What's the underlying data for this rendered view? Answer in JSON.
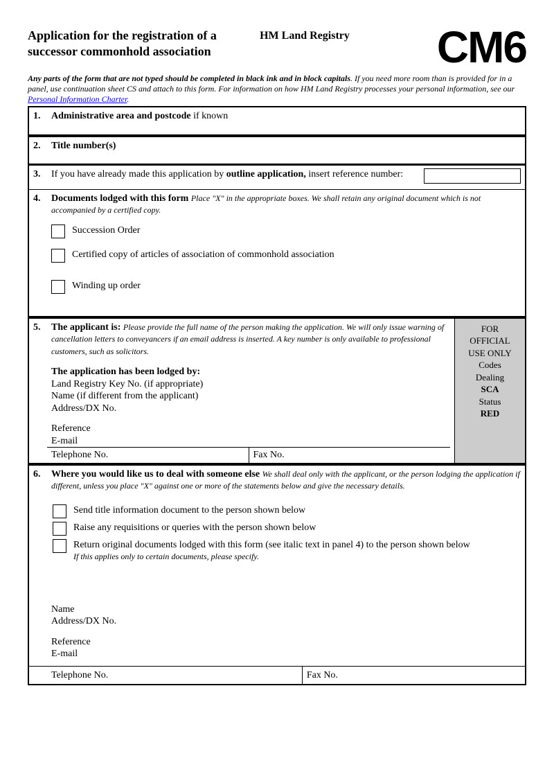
{
  "header": {
    "title": "Application for the registration of a successor commonhold association",
    "registry": "HM Land Registry",
    "form_code": "CM6"
  },
  "instruct": {
    "line": "Any parts of the form that are not typed should be completed in black ink and in block capitals",
    "cont": ". If you need more room than is provided for in a panel, use continuation sheet CS and attach to this form. For information on how HM Land Registry processes your personal information, see our ",
    "link_text": "Personal Information Charter",
    "fullstop": "."
  },
  "p1": {
    "num": "1.",
    "label_bold": "Administrative area and postcode",
    "tail": " if known"
  },
  "p2": {
    "num": "2.",
    "label": "Title number(s)"
  },
  "p3": {
    "num": "3.",
    "pre": "If you have already made this application by ",
    "mid": "outline application,",
    "post": " insert reference number:"
  },
  "p4": {
    "num": "4.",
    "head": "Documents lodged with this form",
    "note": " Place \"X\" in the appropriate boxes.  We shall retain any original document which is not accompanied by a certified copy.",
    "items": [
      "Succession Order",
      "Certified copy of articles of association of commonhold association",
      "Winding up order"
    ]
  },
  "p5": {
    "num": "5.",
    "head": "The applicant is:",
    "note": " Please provide the full name of the person making the application. We will only issue warning of cancellation letters to conveyancers if an email address is inserted. A key number is only available to professional customers, such as solicitors.",
    "lodged_head": "The application has been lodged by:",
    "lines": [
      "Land Registry Key No. (if appropriate)",
      "Name (if different from the applicant)",
      "Address/DX No."
    ],
    "ref": "Reference",
    "email": "E-mail",
    "tel": "Telephone No.",
    "fax": "Fax No.",
    "official": {
      "l1": "FOR",
      "l2": "OFFICIAL",
      "l3": "USE ONLY",
      "l4": "Codes",
      "l5": "Dealing",
      "l6": "SCA",
      "l7": "Status",
      "l8": "RED"
    }
  },
  "p6": {
    "num": "6.",
    "head": "Where you would like us to deal with someone else",
    "note": " We shall deal only with the applicant, or the person lodging the application if different, unless you place \"X\" against one or more of the statements below and give the necessary details.",
    "items": [
      "Send title information document to the person shown below",
      "Raise any requisitions or queries with the person shown below",
      "Return original documents lodged with this form (see italic text in panel 4) to the person shown below"
    ],
    "item3_note": "If this applies only to certain documents, please specify.",
    "name": "Name",
    "addr": "Address/DX No.",
    "ref": "Reference",
    "email": "E-mail",
    "tel": "Telephone No.",
    "fax": "Fax No."
  }
}
